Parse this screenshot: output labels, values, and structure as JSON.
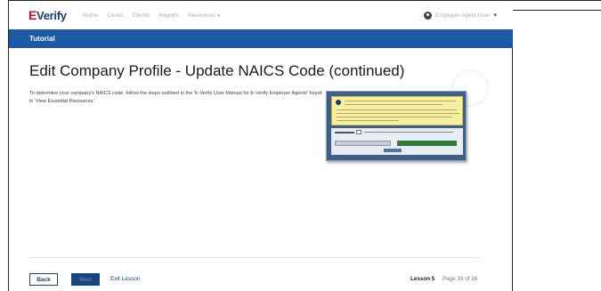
{
  "header": {
    "logo_e": "E",
    "logo_text": "Verify",
    "nav": [
      "Home",
      "Cases",
      "Clients",
      "Reports",
      "Resources"
    ],
    "user_name": "Employer Agent User"
  },
  "band": {
    "label": "Tutorial"
  },
  "main": {
    "title": "Edit Company Profile - Update NAICS Code (continued)",
    "description": "To determine your company's NAICS code, follow the steps outlined in the 'E-Verify User Manual for E-Verify Employer Agents' found in 'View Essential Resources.'"
  },
  "footer": {
    "back_label": "Back",
    "next_label": "Next",
    "exit_label": "Exit Lesson",
    "lesson_label": "Lesson 5",
    "page_label": "Page 19 of 26"
  },
  "colors": {
    "brand_blue": "#1c5aa8",
    "button_blue": "#1a4480",
    "logo_red": "#c8102e"
  },
  "icons": [
    "user-avatar-icon",
    "chevron-down-icon",
    "info-icon"
  ]
}
